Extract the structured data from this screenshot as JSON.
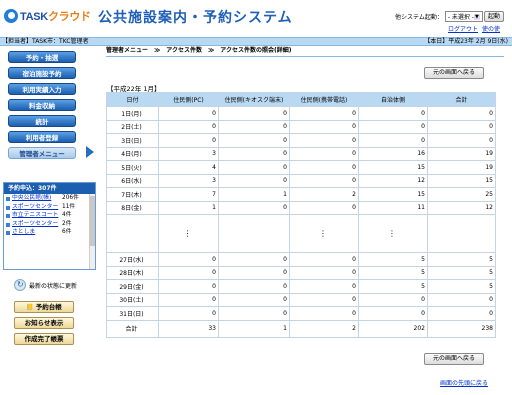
{
  "header": {
    "logo_main": "TASK",
    "logo_sub": "クラウド",
    "title": "公共施設案内・予約システム",
    "sys_label": "他システム起動：",
    "select_value": "- 未選択 -",
    "kidou": "起動",
    "logout": "ログアウト",
    "link2": "使の使"
  },
  "bar": {
    "left": "【担当者】TASK市：TKC管理者",
    "right": "【本日】平成23年 2月 9日(水)"
  },
  "menu": [
    "予約・抽選",
    "宿泊施設予約",
    "利用実績入力",
    "料金収納",
    "統計",
    "利用者登録",
    "管理者メニュー"
  ],
  "yoyaku": {
    "header": "予約申込：307件",
    "items": [
      {
        "name": "中央公民館(帳)",
        "count": "206件"
      },
      {
        "name": "スポーツセンター",
        "count": "11件"
      },
      {
        "name": "市立テニスコート",
        "count": "4件"
      },
      {
        "name": "スポーツセンター",
        "count": "2件"
      },
      {
        "name": "さとしま",
        "count": "6件"
      }
    ]
  },
  "side_actions": {
    "update": "最新の状態に更新",
    "ledger": "予約台帳",
    "notice": "お知らせ表示",
    "complete": "作成完了帳票"
  },
  "breadcrumb": "管理者メニュー　≫　アクセス件数　≫　アクセス件数の照会(詳細)",
  "return_btn": "元の画面へ戻る",
  "year_month": "【平成22年 1月】",
  "table": {
    "headers": [
      "日付",
      "住民側(PC)",
      "住民側(キオスク端末)",
      "住民側(携帯電話)",
      "自治体側",
      "合計"
    ],
    "rows_top": [
      [
        "1日(月)",
        "0",
        "0",
        "0",
        "0",
        "0"
      ],
      [
        "2日(土)",
        "0",
        "0",
        "0",
        "0",
        "0"
      ],
      [
        "3日(日)",
        "0",
        "0",
        "0",
        "0",
        "0"
      ],
      [
        "4日(月)",
        "3",
        "0",
        "0",
        "16",
        "19"
      ],
      [
        "5日(火)",
        "4",
        "0",
        "0",
        "15",
        "19"
      ],
      [
        "6日(水)",
        "3",
        "0",
        "0",
        "12",
        "15"
      ],
      [
        "7日(木)",
        "7",
        "1",
        "2",
        "15",
        "25"
      ],
      [
        "8日(金)",
        "1",
        "0",
        "0",
        "11",
        "12"
      ]
    ],
    "gap": [
      "",
      "⋮",
      "",
      "⋮",
      "⋮",
      ""
    ],
    "rows_bottom": [
      [
        "27日(水)",
        "0",
        "0",
        "0",
        "5",
        "5"
      ],
      [
        "28日(木)",
        "0",
        "0",
        "0",
        "5",
        "5"
      ],
      [
        "29日(金)",
        "0",
        "0",
        "0",
        "5",
        "5"
      ],
      [
        "30日(土)",
        "0",
        "0",
        "0",
        "0",
        "0"
      ],
      [
        "31日(日)",
        "0",
        "0",
        "0",
        "0",
        "0"
      ]
    ],
    "total": [
      "合計",
      "33",
      "1",
      "2",
      "202",
      "238"
    ]
  },
  "foot_link": "画面の先頭に戻る"
}
